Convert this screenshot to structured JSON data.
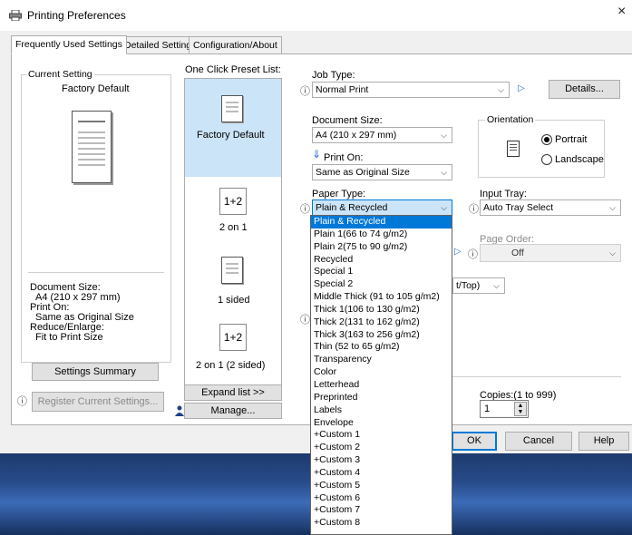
{
  "window": {
    "title": "Printing Preferences",
    "close_glyph": "×"
  },
  "tabs": [
    "Frequently Used Settings",
    "Detailed Settings",
    "Configuration/About"
  ],
  "current_setting": {
    "group_title": "Current Setting",
    "name": "Factory Default",
    "summary": [
      "Document Size:",
      "A4 (210 x 297 mm)",
      "Print On:",
      "Same as Original Size",
      "Reduce/Enlarge:",
      "Fit to Print Size"
    ],
    "settings_summary_button": "Settings Summary",
    "register_button": "Register Current Settings..."
  },
  "presets": {
    "title": "One Click Preset List:",
    "items": [
      {
        "label": "Factory Default",
        "glyph": ""
      },
      {
        "label": "2 on 1",
        "glyph": "1+2"
      },
      {
        "label": "1 sided",
        "glyph": ""
      },
      {
        "label": "2 on 1 (2 sided)",
        "glyph": "1+2"
      }
    ],
    "expand_button": "Expand list >>",
    "manage_button": "Manage..."
  },
  "job_type": {
    "label": "Job Type:",
    "value": "Normal Print",
    "details_button": "Details..."
  },
  "document_size": {
    "label": "Document Size:",
    "value": "A4 (210 x 297 mm)"
  },
  "print_on": {
    "label": "Print On:",
    "value": "Same as Original Size"
  },
  "orientation": {
    "group_title": "Orientation",
    "portrait": "Portrait",
    "landscape": "Landscape",
    "selected": "Portrait"
  },
  "paper_type": {
    "label": "Paper Type:",
    "value": "Plain & Recycled",
    "options": [
      "Plain & Recycled",
      "Plain 1(66 to 74 g/m2)",
      "Plain 2(75 to 90 g/m2)",
      "Recycled",
      "Special 1",
      "Special 2",
      "Middle Thick (91 to 105 g/m2)",
      "Thick 1(106 to 130 g/m2)",
      "Thick 2(131 to 162 g/m2)",
      "Thick 3(163 to 256 g/m2)",
      "Thin (52 to 65 g/m2)",
      "Transparency",
      "Color",
      "Letterhead",
      "Preprinted",
      "Labels",
      "Envelope",
      "+Custom 1",
      "+Custom 2",
      "+Custom 3",
      "+Custom 4",
      "+Custom 5",
      "+Custom 6",
      "+Custom 7",
      "+Custom 8"
    ]
  },
  "input_tray": {
    "label": "Input Tray:",
    "value": "Auto Tray Select"
  },
  "page_order": {
    "label": "Page Order:",
    "value": "Off"
  },
  "partial_combo": {
    "value": "t/Top)"
  },
  "copies": {
    "label": "Copies:(1 to 999)",
    "value": "1"
  },
  "footer": {
    "ok": "OK",
    "cancel": "Cancel",
    "help": "Help"
  },
  "icons": {
    "info": "ⓘ",
    "play": "▷",
    "chevron": "⌵",
    "spin_up": "▲",
    "spin_down": "▼",
    "print_on_arrow": "⇓"
  }
}
